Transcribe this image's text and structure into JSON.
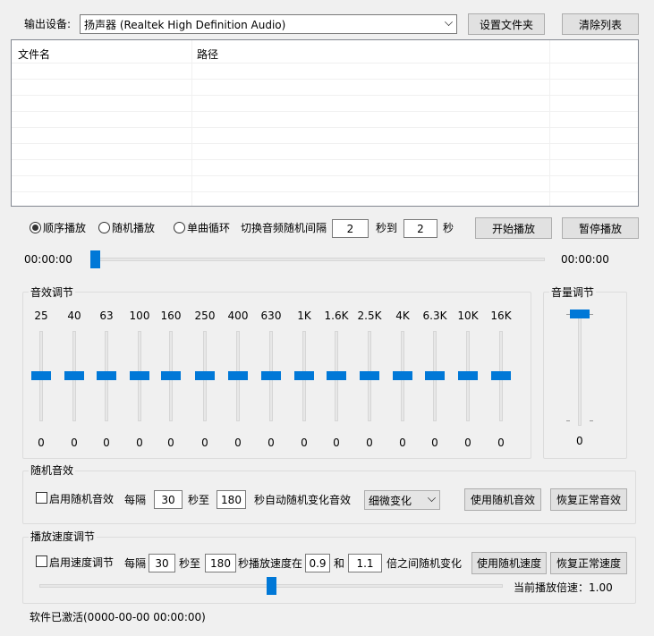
{
  "device": {
    "label": "输出设备:",
    "selected": "扬声器 (Realtek High Definition Audio)",
    "set_folder_button": "设置文件夹",
    "clear_list_button": "清除列表"
  },
  "filelist": {
    "col_name": "文件名",
    "col_path": "路径"
  },
  "playback": {
    "mode_sequential": "顺序播放",
    "mode_random": "随机播放",
    "mode_single_loop": "单曲循环",
    "switch_interval_label": "切换音频随机间隔",
    "interval_from": "2",
    "sec_to_label": "秒到",
    "interval_to": "2",
    "sec_label": "秒",
    "start_button": "开始播放",
    "pause_button": "暂停播放",
    "time_current": "00:00:00",
    "time_total": "00:00:00",
    "progress": 0.0
  },
  "eq": {
    "title": "音效调节",
    "bands": [
      {
        "freq": "25",
        "value": "0"
      },
      {
        "freq": "40",
        "value": "0"
      },
      {
        "freq": "63",
        "value": "0"
      },
      {
        "freq": "100",
        "value": "0"
      },
      {
        "freq": "160",
        "value": "0"
      },
      {
        "freq": "250",
        "value": "0"
      },
      {
        "freq": "400",
        "value": "0"
      },
      {
        "freq": "630",
        "value": "0"
      },
      {
        "freq": "1K",
        "value": "0"
      },
      {
        "freq": "1.6K",
        "value": "0"
      },
      {
        "freq": "2.5K",
        "value": "0"
      },
      {
        "freq": "4K",
        "value": "0"
      },
      {
        "freq": "6.3K",
        "value": "0"
      },
      {
        "freq": "10K",
        "value": "0"
      },
      {
        "freq": "16K",
        "value": "0"
      }
    ]
  },
  "volume": {
    "title": "音量调节",
    "value": "0"
  },
  "random_effect": {
    "title": "随机音效",
    "enable_label": "启用随机音效",
    "every_label": "每隔",
    "from": "30",
    "to_label": "秒至",
    "to": "180",
    "suffix_label": "秒自动随机变化音效",
    "mode_selected": "细微变化",
    "use_button": "使用随机音效",
    "restore_button": "恢复正常音效"
  },
  "speed": {
    "title": "播放速度调节",
    "enable_label": "启用速度调节",
    "every_label": "每隔",
    "from": "30",
    "to_label": "秒至",
    "to": "180",
    "range_label": "秒播放速度在",
    "min": "0.9",
    "and_label": "和",
    "max": "1.1",
    "between_label": "倍之间随机变化",
    "use_button": "使用随机速度",
    "restore_button": "恢复正常速度",
    "current_label": "当前播放倍速：1.00",
    "slider_fraction": 0.5
  },
  "status": {
    "text": "软件已激活(0000-00-00 00:00:00)"
  },
  "colors": {
    "accent": "#0078d7",
    "background": "#f0f0f0"
  }
}
